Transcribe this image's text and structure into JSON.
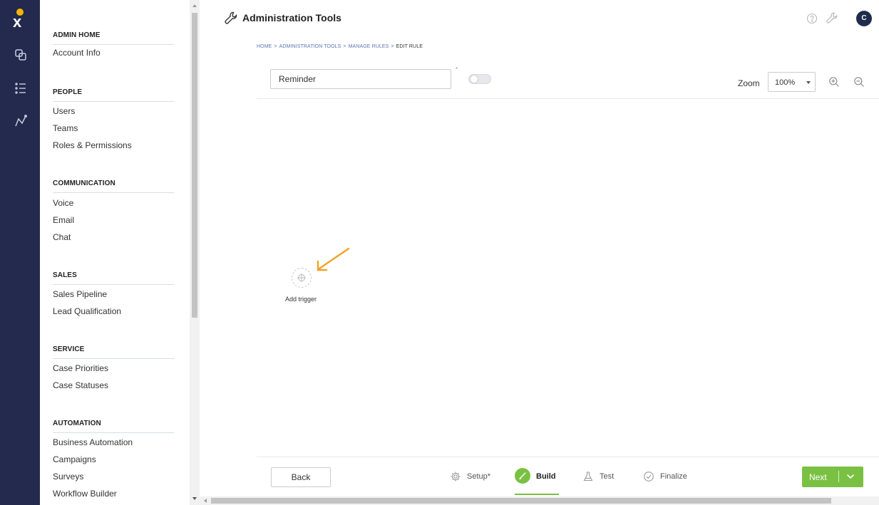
{
  "header": {
    "title": "Administration Tools",
    "avatar_initial": "C"
  },
  "breadcrumb": {
    "items": [
      "HOME",
      "ADMINISTRATION TOOLS",
      "MANAGE RULES"
    ],
    "separator": ">",
    "current": "EDIT RULE"
  },
  "sidenav": {
    "admin_home": "ADMIN HOME",
    "account_info": "Account Info",
    "sections": [
      {
        "title": "PEOPLE",
        "items": [
          "Users",
          "Teams",
          "Roles & Permissions"
        ]
      },
      {
        "title": "COMMUNICATION",
        "items": [
          "Voice",
          "Email",
          "Chat"
        ]
      },
      {
        "title": "SALES",
        "items": [
          "Sales Pipeline",
          "Lead Qualification"
        ]
      },
      {
        "title": "SERVICE",
        "items": [
          "Case Priorities",
          "Case Statuses"
        ]
      },
      {
        "title": "AUTOMATION",
        "items": [
          "Business Automation",
          "Campaigns",
          "Surveys",
          "Workflow Builder"
        ]
      }
    ]
  },
  "rule": {
    "name_value": "Reminder",
    "required_mark": "*",
    "enabled": false
  },
  "zoom": {
    "label": "Zoom",
    "value": "100%"
  },
  "canvas": {
    "add_trigger_label": "Add trigger"
  },
  "footer": {
    "back_label": "Back",
    "steps": [
      {
        "label": "Setup*",
        "icon": "gear-icon"
      },
      {
        "label": "Build",
        "icon": "pencil-icon",
        "active": true
      },
      {
        "label": "Test",
        "icon": "flask-icon"
      },
      {
        "label": "Finalize",
        "icon": "check-circle-icon"
      }
    ],
    "next_label": "Next"
  },
  "colors": {
    "rail": "#232a4e",
    "accent_green": "#7ac143",
    "arrow": "#f0a326",
    "breadcrumb_link": "#5b74b0"
  }
}
